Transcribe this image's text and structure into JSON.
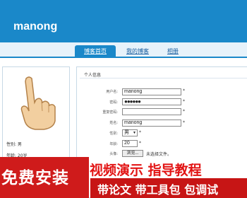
{
  "header": {
    "site_title": "manong"
  },
  "nav": {
    "tabs": [
      {
        "label": "博客首页"
      },
      {
        "label": "我的博客"
      },
      {
        "label": "相册"
      }
    ]
  },
  "left": {
    "gender": "性别: 男",
    "age": "年龄: 20岁"
  },
  "form": {
    "title": "个人信息",
    "username_label": "用户名:",
    "username_value": "manong",
    "password_label": "密码:",
    "password_value": "●●●●●●",
    "confirm_label": "重复密码:",
    "name_label": "姓名:",
    "name_value": "manong",
    "gender_label": "性别:",
    "gender_value": "男",
    "age_label": "年龄:",
    "age_value": "20",
    "avatar_label": "头像:",
    "file_button": "浏览...",
    "file_status": "未选择文件。",
    "required_mark": "*"
  },
  "promo": {
    "left_text": "免费安装",
    "right_top": "视频演示 指导教程",
    "bottom_text": "带论文 带工具包 包调试"
  },
  "colors": {
    "header": "#1a88c9",
    "promo_red": "#c71515"
  }
}
